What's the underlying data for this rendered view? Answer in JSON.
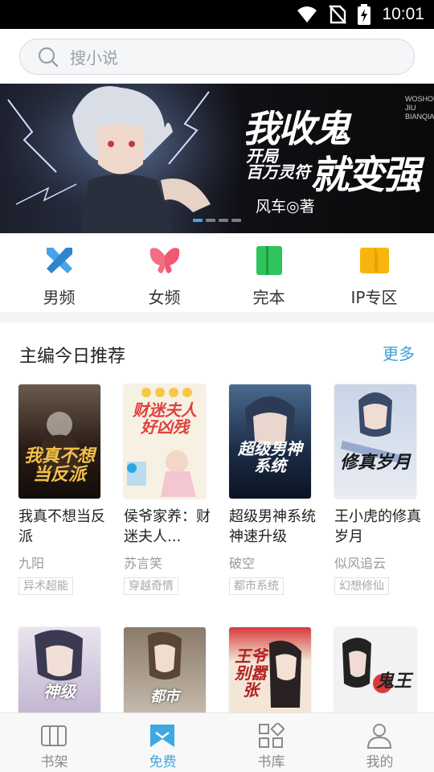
{
  "status_bar": {
    "time": "10:01"
  },
  "search": {
    "placeholder": "搜小说"
  },
  "banner": {
    "title_line1": "我收鬼",
    "title_line2_small": "开局\n百万灵符",
    "title_line2_big": "就变强",
    "pinyin": "WOSHOUGUO JIU BIANQIANG",
    "author": "风车◎著",
    "page_count": 4,
    "active_page": 1
  },
  "categories": [
    {
      "label": "男频",
      "icon": "swords-icon",
      "color": "#3f9de0"
    },
    {
      "label": "女频",
      "icon": "butterfly-icon",
      "color": "#f06a7e"
    },
    {
      "label": "完本",
      "icon": "book-complete-icon",
      "color": "#31c65a"
    },
    {
      "label": "IP专区",
      "icon": "open-book-icon",
      "color": "#f5b10a"
    }
  ],
  "recommend": {
    "title": "主编今日推荐",
    "more": "更多",
    "books": [
      {
        "title": "我真不想当反派",
        "author": "九阳",
        "tag": "异术超能",
        "cover_text": "我真不想当反派",
        "cover_bg": "#2a1d16",
        "cover_fg": "#f3c04a"
      },
      {
        "title": "侯爷家养：财迷夫人...",
        "author": "苏言笑",
        "tag": "穿越奇情",
        "cover_text": "财迷夫人好凶残",
        "cover_bg": "#f7f1e3",
        "cover_fg": "#e0413c"
      },
      {
        "title": "超级男神系统神速升级",
        "author": "破空",
        "tag": "都市系统",
        "cover_text": "超级男神系统",
        "cover_bg": "#1b2a44",
        "cover_fg": "#ffffff"
      },
      {
        "title": "王小虎的修真岁月",
        "author": "似风追云",
        "tag": "幻想修仙",
        "cover_text": "修真岁月",
        "cover_bg": "#e8ecf4",
        "cover_fg": "#1a1a1a"
      }
    ],
    "books_row2": [
      {
        "cover_text": "神级",
        "cover_bg": "#cfc3da",
        "cover_fg": "#ffffff"
      },
      {
        "cover_text": "都市",
        "cover_bg": "#bdb2a4",
        "cover_fg": "#ffffff"
      },
      {
        "cover_text": "王爷别嚣张",
        "cover_bg": "#f3e6d6",
        "cover_fg": "#b22020"
      },
      {
        "cover_text": "鬼王",
        "cover_bg": "#f2f2f2",
        "cover_fg": "#222222"
      }
    ]
  },
  "bottom_nav": [
    {
      "label": "书架",
      "icon": "bookshelf-icon",
      "active": false
    },
    {
      "label": "免费",
      "icon": "free-bookmark-icon",
      "active": true
    },
    {
      "label": "书库",
      "icon": "library-grid-icon",
      "active": false
    },
    {
      "label": "我的",
      "icon": "profile-icon",
      "active": false
    }
  ],
  "colors": {
    "accent": "#3fa8e0",
    "more_link": "#3da0d9"
  }
}
